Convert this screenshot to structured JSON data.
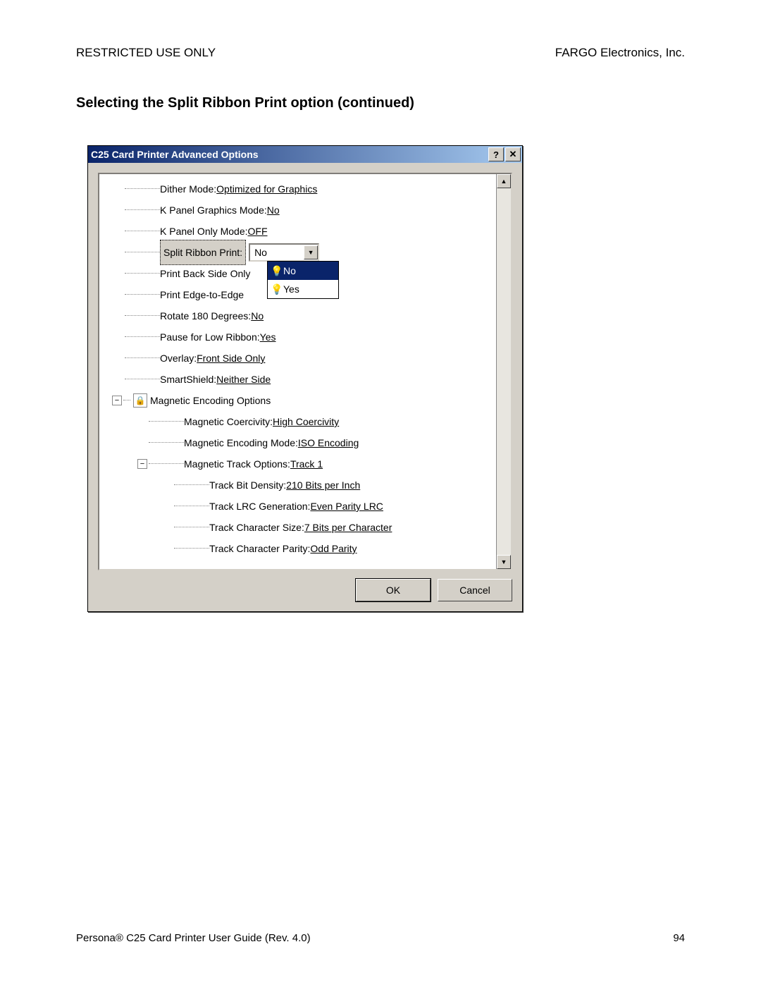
{
  "header": {
    "left": "RESTRICTED USE ONLY",
    "right": "FARGO Electronics, Inc."
  },
  "section_title": "Selecting the Split Ribbon Print option (continued)",
  "dialog": {
    "title": "C25 Card Printer Advanced Options",
    "help_btn": "?",
    "close_btn": "✕",
    "ok": "OK",
    "cancel": "Cancel"
  },
  "tree": {
    "dither_mode_label": "Dither Mode: ",
    "dither_mode_value": "Optimized for Graphics",
    "k_panel_graphics_label": "K Panel Graphics Mode: ",
    "k_panel_graphics_value": "No",
    "k_panel_only_label": "K Panel Only Mode: ",
    "k_panel_only_value": "OFF",
    "split_ribbon_label": "Split Ribbon Print:",
    "split_ribbon_value": "No",
    "print_back_label": "Print Back Side Only",
    "print_edge_label": "Print Edge-to-Edge",
    "rotate_label": "Rotate 180 Degrees: ",
    "rotate_value": "No",
    "pause_label": "Pause for Low Ribbon: ",
    "pause_value": "Yes",
    "overlay_label": "Overlay: ",
    "overlay_value": "Front Side Only",
    "smartshield_label": "SmartShield: ",
    "smartshield_value": "Neither Side",
    "mag_encoding_options": "Magnetic Encoding Options",
    "mag_coerc_label": "Magnetic Coercivity: ",
    "mag_coerc_value": "High Coercivity",
    "mag_mode_label": "Magnetic Encoding Mode: ",
    "mag_mode_value": "ISO Encoding",
    "mag_track_label": "Magnetic Track Options: ",
    "mag_track_value": "Track 1",
    "track_bit_label": "Track Bit Density: ",
    "track_bit_value": "210 Bits per Inch",
    "track_lrc_label": "Track LRC Generation: ",
    "track_lrc_value": "Even Parity LRC",
    "track_char_size_label": "Track Character Size: ",
    "track_char_size_value": "7 Bits per Character",
    "track_char_parity_label": "Track Character Parity: ",
    "track_char_parity_value": "Odd Parity"
  },
  "dropdown": {
    "opt_no": "No",
    "opt_yes": "Yes"
  },
  "footer": {
    "left": "Persona® C25 Card Printer User Guide (Rev. 4.0)",
    "page": "94"
  }
}
